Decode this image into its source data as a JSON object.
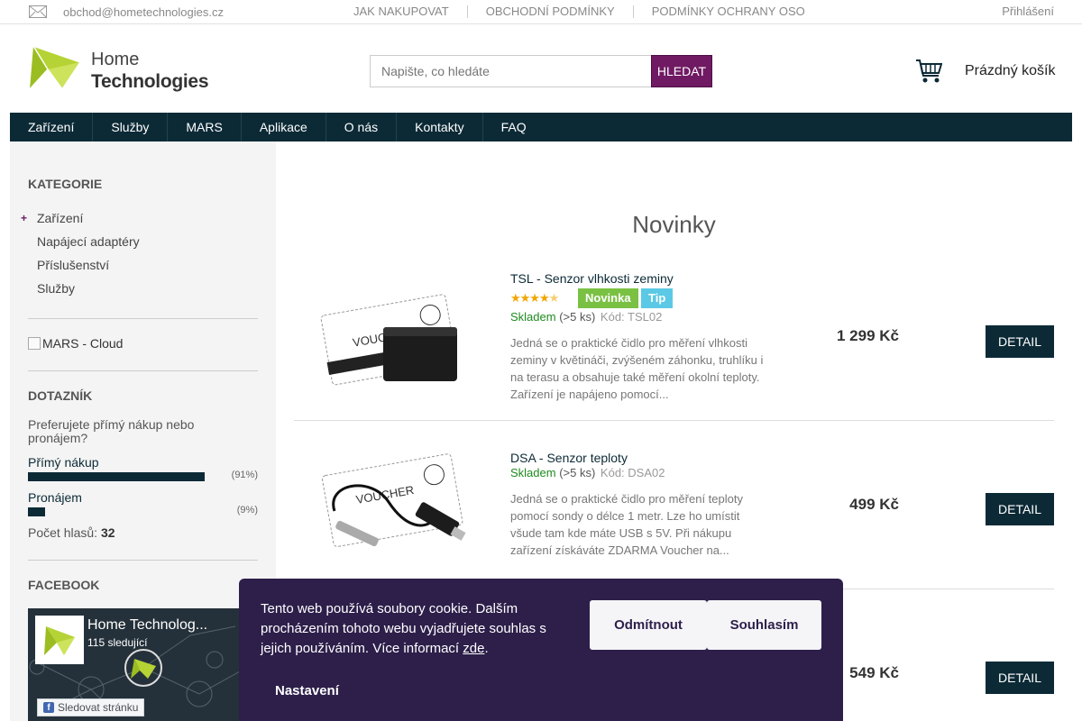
{
  "topbar": {
    "email": "obchod@hometechnologies.cz",
    "links": [
      "JAK NAKUPOVAT",
      "OBCHODNÍ PODMÍNKY",
      "PODMÍNKY OCHRANY OSO"
    ],
    "login": "Přihlášení"
  },
  "header": {
    "logo_line1": "Home",
    "logo_line2": "Technologies",
    "search_placeholder": "Napište, co hledáte",
    "search_button": "HLEDAT",
    "cart_label": "Prázdný košík"
  },
  "nav": {
    "items": [
      "Zařízení",
      "Služby",
      "MARS",
      "Aplikace",
      "O nás",
      "Kontakty",
      "FAQ"
    ]
  },
  "sidebar": {
    "categories_title": "KATEGORIE",
    "categories": [
      "Zařízení",
      "Napájecí adaptéry",
      "Příslušenství",
      "Služby"
    ],
    "mars_alt": "MARS - Cloud",
    "poll_title": "DOTAZNÍK",
    "poll_question": "Preferujete přímý nákup nebo pronájem?",
    "poll_options": [
      {
        "label": "Přímý nákup",
        "percent_text": "(91%)",
        "percent": 91
      },
      {
        "label": "Pronájem",
        "percent_text": "(9%)",
        "percent": 9
      }
    ],
    "votes_label": "Počet hlasů:",
    "votes_count": "32",
    "facebook_title": "FACEBOOK",
    "fb_page_name": "Home Technolog...",
    "fb_followers": "115 sledující",
    "fb_follow_button": "Sledovat stránku"
  },
  "main": {
    "title": "Novinky",
    "products": [
      {
        "name": "TSL - Senzor vlhkosti zeminy",
        "rating": 4.5,
        "badges": [
          "Novinka",
          "Tip"
        ],
        "stock": "Skladem",
        "stock_count": "(>5 ks)",
        "code": "Kód: TSL02",
        "description": "Jedná se o praktické čidlo pro měření vlhkosti zeminy v květináči, zvýšeném záhonku, truhlíku i na terasu a obsahuje také měření okolní teploty. Zařízení je napájeno pomocí...",
        "price": "1 299 Kč",
        "detail": "DETAIL",
        "voucher_text": "VOUCHER"
      },
      {
        "name": "DSA - Senzor teploty",
        "stock": "Skladem",
        "stock_count": "(>5 ks)",
        "code": "Kód: DSA02",
        "description": "Jedná se o praktické čidlo pro měření teploty pomocí sondy o délce 1 metr. Lze ho umístit všude tam kde máte USB s 5V. Při nákupu zařízení získáváte ZDARMA Voucher na...",
        "price": "499 Kč",
        "detail": "DETAIL",
        "voucher_text": "VOUCHER"
      },
      {
        "price": "549 Kč",
        "detail": "DETAIL"
      }
    ]
  },
  "cookie": {
    "text": "Tento web používá soubory cookie. Dalším procházením tohoto webu vyjadřujete souhlas s jejich používáním. Více informací ",
    "link": "zde",
    "text_end": ".",
    "decline": "Odmítnout",
    "accept": "Souhlasím",
    "settings": "Nastavení"
  },
  "colors": {
    "nav_bg": "#0c2a36",
    "search_button": "#6f1a63",
    "cookie_bg": "#2d1f4a",
    "logo_green": "#b5d334",
    "stock_green": "#1f8a1f",
    "badge_new": "#7ac143",
    "badge_tip": "#5bc9e5"
  }
}
